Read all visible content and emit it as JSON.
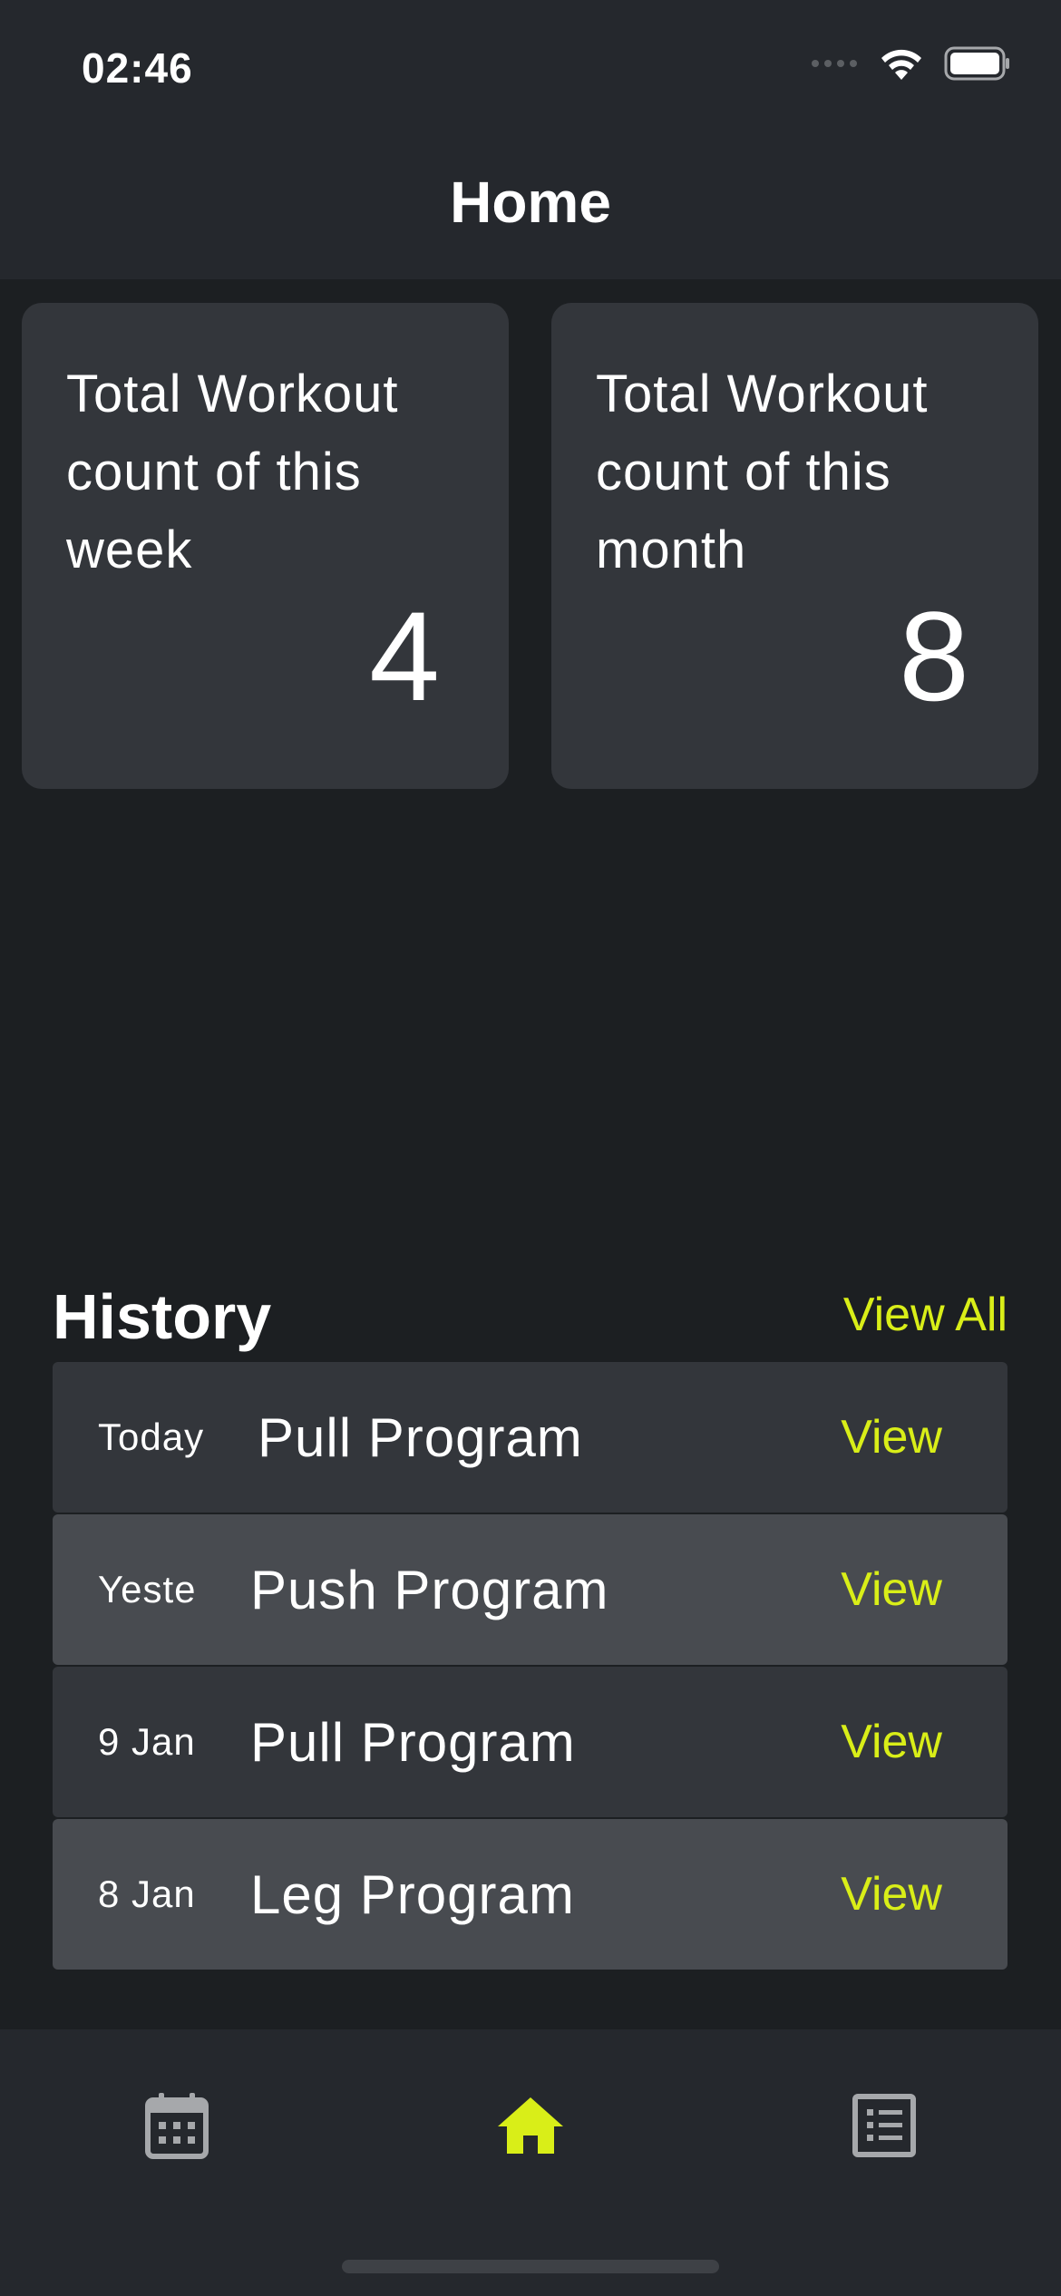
{
  "status_bar": {
    "time": "02:46"
  },
  "header": {
    "title": "Home"
  },
  "stats": [
    {
      "label": "Total Workout count of this week",
      "value": "4"
    },
    {
      "label": "Total Workout count of this month",
      "value": "8"
    }
  ],
  "history": {
    "title": "History",
    "view_all_label": "View All",
    "items": [
      {
        "date": "Today",
        "program": "Pull Program",
        "action": "View"
      },
      {
        "date": "Yeste",
        "program": "Push Program",
        "action": "View"
      },
      {
        "date": "9 Jan",
        "program": "Pull Program",
        "action": "View"
      },
      {
        "date": "8 Jan",
        "program": "Leg Program",
        "action": "View"
      }
    ]
  },
  "tab_bar": {
    "tabs": [
      {
        "icon": "calendar-icon",
        "active": false
      },
      {
        "icon": "home-icon",
        "active": true
      },
      {
        "icon": "list-icon",
        "active": false
      }
    ]
  },
  "colors": {
    "accent": "#d9ee18",
    "background": "#1c1f22",
    "bar_background": "#25282d",
    "card_background": "#33363b",
    "row_alt_background": "#484b50",
    "inactive_icon": "#a6a8ab"
  }
}
